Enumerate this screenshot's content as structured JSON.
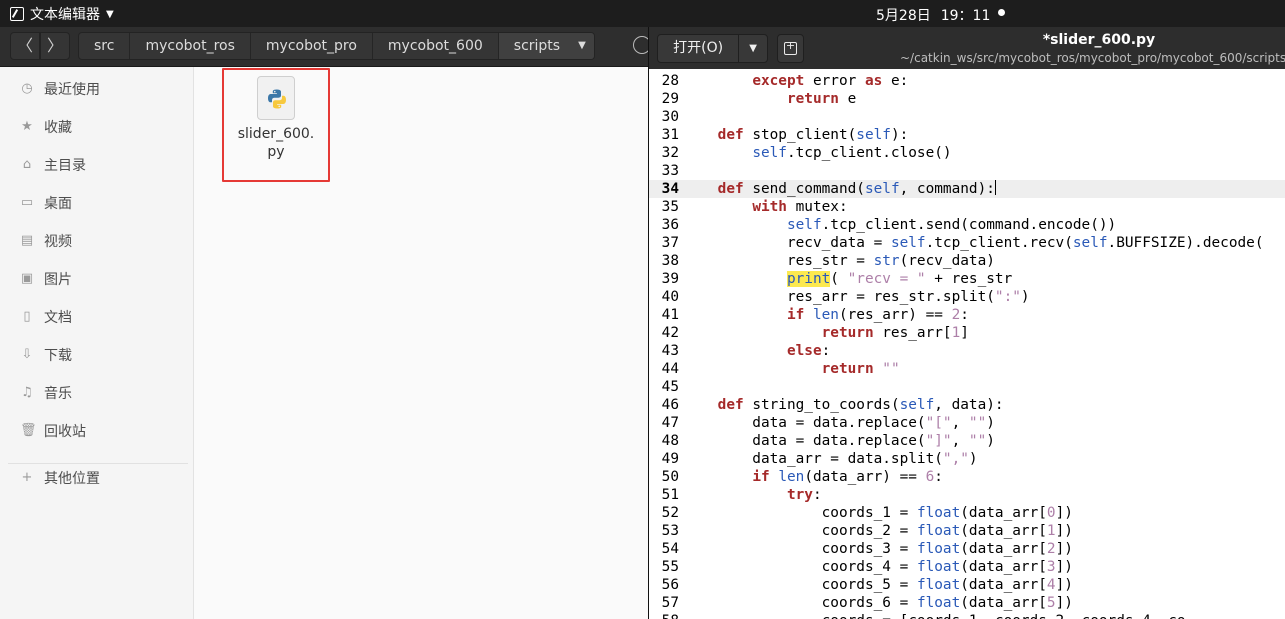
{
  "topbar": {
    "app_name": "文本编辑器",
    "date": "5月28日",
    "time": "19：11"
  },
  "file_manager": {
    "breadcrumbs": [
      "src",
      "mycobot_ros",
      "mycobot_pro",
      "mycobot_600",
      "scripts"
    ],
    "sidebar": [
      {
        "label": "最近使用",
        "icon": "clock-icon"
      },
      {
        "label": "收藏",
        "icon": "star-icon"
      },
      {
        "label": "主目录",
        "icon": "home-icon"
      },
      {
        "label": "桌面",
        "icon": "desktop-icon"
      },
      {
        "label": "视频",
        "icon": "video-icon"
      },
      {
        "label": "图片",
        "icon": "picture-icon"
      },
      {
        "label": "文档",
        "icon": "document-icon"
      },
      {
        "label": "下载",
        "icon": "download-icon"
      },
      {
        "label": "音乐",
        "icon": "music-icon"
      },
      {
        "label": "回收站",
        "icon": "trash-icon"
      },
      {
        "label": "其他位置",
        "icon": "plus-icon"
      }
    ],
    "file": {
      "name_line1": "slider_600.",
      "name_line2": "py",
      "icon": "python-file-icon"
    }
  },
  "editor": {
    "open_label": "打开(O)",
    "title": "*slider_600.py",
    "path": "~/catkin_ws/src/mycobot_ros/mycobot_pro/mycobot_600/scripts",
    "current_line": 34,
    "colors": {
      "keyword": "#a52a2a",
      "builtin": "#2a59b7",
      "string": "#ad7fa8",
      "highlight": "#fce94f"
    },
    "lines": [
      {
        "n": "28",
        "text": "        except error as e:"
      },
      {
        "n": "29",
        "text": "            return e"
      },
      {
        "n": "30",
        "text": ""
      },
      {
        "n": "31",
        "text": "    def stop_client(self):"
      },
      {
        "n": "32",
        "text": "        self.tcp_client.close()"
      },
      {
        "n": "33",
        "text": ""
      },
      {
        "n": "34",
        "text": "    def send_command(self, command):"
      },
      {
        "n": "35",
        "text": "        with mutex:"
      },
      {
        "n": "36",
        "text": "            self.tcp_client.send(command.encode())"
      },
      {
        "n": "37",
        "text": "            recv_data = self.tcp_client.recv(self.BUFFSIZE).decode("
      },
      {
        "n": "38",
        "text": "            res_str = str(recv_data)"
      },
      {
        "n": "39",
        "text": "            print( \"recv = \" + res_str"
      },
      {
        "n": "40",
        "text": "            res_arr = res_str.split(\":\")"
      },
      {
        "n": "41",
        "text": "            if len(res_arr) == 2:"
      },
      {
        "n": "42",
        "text": "                return res_arr[1]"
      },
      {
        "n": "43",
        "text": "            else:"
      },
      {
        "n": "44",
        "text": "                return \"\""
      },
      {
        "n": "45",
        "text": ""
      },
      {
        "n": "46",
        "text": "    def string_to_coords(self, data):"
      },
      {
        "n": "47",
        "text": "        data = data.replace(\"[\", \"\")"
      },
      {
        "n": "48",
        "text": "        data = data.replace(\"]\", \"\")"
      },
      {
        "n": "49",
        "text": "        data_arr = data.split(\",\")"
      },
      {
        "n": "50",
        "text": "        if len(data_arr) == 6:"
      },
      {
        "n": "51",
        "text": "            try:"
      },
      {
        "n": "52",
        "text": "                coords_1 = float(data_arr[0])"
      },
      {
        "n": "53",
        "text": "                coords_2 = float(data_arr[1])"
      },
      {
        "n": "54",
        "text": "                coords_3 = float(data_arr[2])"
      },
      {
        "n": "55",
        "text": "                coords_4 = float(data_arr[3])"
      },
      {
        "n": "56",
        "text": "                coords_5 = float(data_arr[4])"
      },
      {
        "n": "57",
        "text": "                coords_6 = float(data_arr[5])"
      },
      {
        "n": "58",
        "text": "                coords = [coords_1, coords_2, coords_4, co"
      }
    ]
  }
}
